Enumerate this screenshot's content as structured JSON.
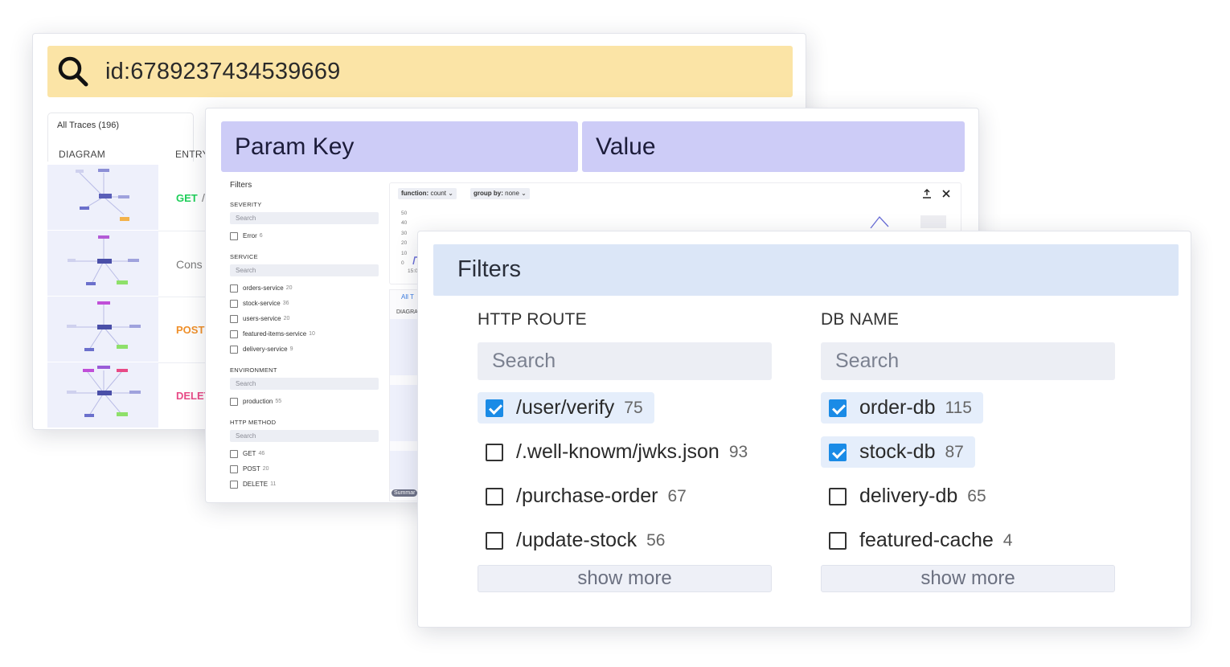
{
  "traces": {
    "search_query": "id:6789237434539669",
    "tab_label": "All Traces (196)",
    "columns": [
      "DIAGRAM",
      "ENTRY"
    ],
    "rows": [
      {
        "method": "GET",
        "suffix": "/"
      },
      {
        "method": "Cons",
        "suffix": ""
      },
      {
        "method": "POST",
        "suffix": ""
      },
      {
        "method": "DELET",
        "suffix": ""
      }
    ]
  },
  "params": {
    "key_header": "Param Key",
    "value_header": "Value",
    "filters_title": "Filters",
    "sections": [
      {
        "title": "SEVERITY",
        "search": "Search",
        "items": [
          {
            "label": "Error",
            "count": "6"
          }
        ]
      },
      {
        "title": "SERVICE",
        "search": "Search",
        "items": [
          {
            "label": "orders-service",
            "count": "20"
          },
          {
            "label": "stock-service",
            "count": "36"
          },
          {
            "label": "users-service",
            "count": "20"
          },
          {
            "label": "featured-items-service",
            "count": "10"
          },
          {
            "label": "delivery-service",
            "count": "9"
          }
        ]
      },
      {
        "title": "ENVIRONMENT",
        "search": "Search",
        "items": [
          {
            "label": "production",
            "count": "55"
          }
        ]
      },
      {
        "title": "HTTP METHOD",
        "search": "Search",
        "items": [
          {
            "label": "GET",
            "count": "46"
          },
          {
            "label": "POST",
            "count": "20"
          },
          {
            "label": "DELETE",
            "count": "11"
          }
        ]
      }
    ],
    "chart": {
      "function_label": "function:",
      "function_value": "count",
      "group_label": "group by:",
      "group_value": "none",
      "yticks": [
        "50",
        "40",
        "30",
        "20",
        "10",
        "0"
      ],
      "xtick": "15:0",
      "export_icon": "upload-icon",
      "close_icon": "close-icon"
    },
    "side_labels": {
      "tab": "All T",
      "col": "DIAGRA",
      "badge": "Summar"
    }
  },
  "filters": {
    "title": "Filters",
    "columns": [
      {
        "title": "HTTP ROUTE",
        "search_placeholder": "Search",
        "items": [
          {
            "label": "/user/verify",
            "count": "75",
            "checked": true
          },
          {
            "label": "/.well-knowm/jwks.json",
            "count": "93",
            "checked": false
          },
          {
            "label": "/purchase-order",
            "count": "67",
            "checked": false
          },
          {
            "label": "/update-stock",
            "count": "56",
            "checked": false
          }
        ],
        "show_more": "show more"
      },
      {
        "title": "DB NAME",
        "search_placeholder": "Search",
        "items": [
          {
            "label": "order-db",
            "count": "115",
            "checked": true
          },
          {
            "label": "stock-db",
            "count": "87",
            "checked": true
          },
          {
            "label": "delivery-db",
            "count": "65",
            "checked": false
          },
          {
            "label": "featured-cache",
            "count": "4",
            "checked": false
          }
        ],
        "show_more": "show more"
      }
    ]
  },
  "colors": {
    "search_bg": "#fbe4a6",
    "param_header_bg": "#cdccf7",
    "filter_header_bg": "#dbe6f7",
    "checkbox_checked": "#1a8be6",
    "get": "#1fcf5a",
    "post": "#f0902a",
    "delete": "#e84a86"
  }
}
